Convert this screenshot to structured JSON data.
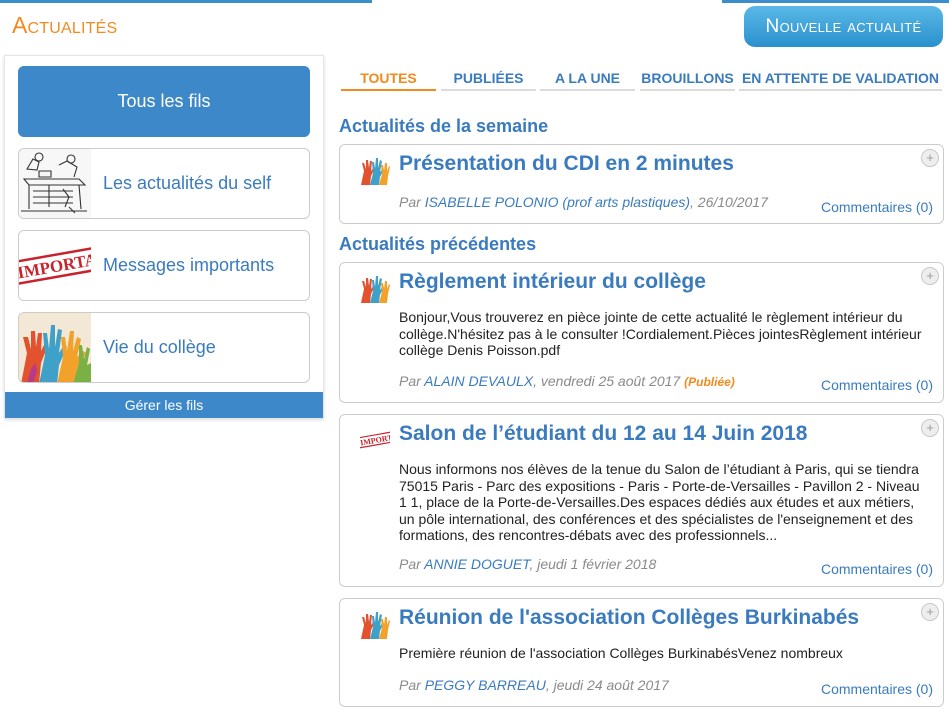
{
  "header": {
    "title": "Actualités",
    "new_button": "Nouvelle actualité"
  },
  "sidebar": {
    "threads": [
      {
        "label": "Tous les fils",
        "icon": "none",
        "active": true
      },
      {
        "label": "Les actualités du self",
        "icon": "canteen-sketch-icon"
      },
      {
        "label": "Messages importants",
        "icon": "important-stamp-icon",
        "stamp_text": "IMPORTANT"
      },
      {
        "label": "Vie du collège",
        "icon": "raised-hands-icon"
      }
    ],
    "manage_label": "Gérer les fils"
  },
  "tabs": [
    {
      "label": "TOUTES",
      "active": true
    },
    {
      "label": "PUBLIÉES"
    },
    {
      "label": "A LA UNE"
    },
    {
      "label": "BROUILLONS"
    },
    {
      "label": "EN ATTENTE DE VALIDATION"
    }
  ],
  "sections": {
    "week": "Actualités de la semaine",
    "previous": "Actualités précédentes"
  },
  "articles": [
    {
      "title": "Présentation du CDI en 2 minutes",
      "icon": "raised-hands-icon",
      "body": "",
      "meta_prefix": "Par ",
      "author": "ISABELLE POLONIO (prof arts plastiques)",
      "date": ", 26/10/2017",
      "status": "",
      "comments": "Commentaires (0)"
    },
    {
      "title": "Règlement intérieur du collège",
      "icon": "raised-hands-icon",
      "body": "Bonjour,Vous trouverez en pièce jointe de cette actualité le règlement intérieur du collège.N'hésitez pas à le consulter !Cordialement.Pièces jointesRèglement intérieur collège Denis Poisson.pdf",
      "meta_prefix": "Par ",
      "author": "ALAIN DEVAULX",
      "date": ", vendredi 25 août 2017 ",
      "status": "(Publiée)",
      "comments": "Commentaires (0)"
    },
    {
      "title": "Salon de l’étudiant du 12 au 14 Juin 2018",
      "icon": "important-stamp-icon",
      "body": "Nous informons nos élèves de la tenue du Salon de l’étudiant à Paris, qui se tiendra 75015 Paris - Parc des expositions - Paris - Porte-de-Versailles - Pavillon 2 - Niveau 1 1, place de la Porte-de-Versailles.Des espaces dédiés aux études et aux métiers, un pôle international, des conférences et des spécialistes de l'enseignement et des formations, des rencontres-débats avec des professionnels...",
      "meta_prefix": "Par ",
      "author": "ANNIE DOGUET",
      "date": ", jeudi 1 février 2018",
      "status": "",
      "comments": "Commentaires (0)"
    },
    {
      "title": "Réunion de l'association Collèges Burkinabés",
      "icon": "raised-hands-icon",
      "body": "Première réunion de l'association Collèges BurkinabésVenez nombreux",
      "meta_prefix": "Par ",
      "author": "PEGGY BARREAU",
      "date": ", jeudi 24 août 2017",
      "status": "",
      "comments": "Commentaires (0)"
    }
  ],
  "colors": {
    "accent_orange": "#f28a1e",
    "primary_blue": "#3d88c9",
    "link_blue": "#3a7bbf"
  }
}
